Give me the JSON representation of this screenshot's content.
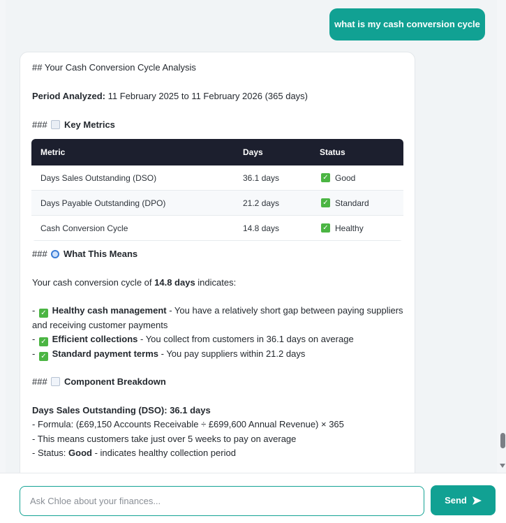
{
  "user_message": "what is my cash conversion cycle",
  "response": {
    "heading": "## Your Cash Conversion Cycle Analysis",
    "period_label": "Period Analyzed:",
    "period_value": " 11 February 2025 to 11 February 2026 (365 days)",
    "key_metrics_prefix": "### ",
    "key_metrics_title": "Key Metrics",
    "table": {
      "headers": [
        "Metric",
        "Days",
        "Status"
      ],
      "rows": [
        {
          "metric": "Days Sales Outstanding (DSO)",
          "days": "36.1 days",
          "status": "Good"
        },
        {
          "metric": "Days Payable Outstanding (DPO)",
          "days": "21.2 days",
          "status": "Standard"
        },
        {
          "metric": "Cash Conversion Cycle",
          "days": "14.8 days",
          "status": "Healthy"
        }
      ]
    },
    "means_prefix": "### ",
    "means_title": "What This Means",
    "indicates_pre": "Your cash conversion cycle of ",
    "indicates_bold": "14.8 days",
    "indicates_post": " indicates:",
    "bullets": [
      {
        "bold": "Healthy cash management",
        "text": " - You have a relatively short gap between paying suppliers",
        "cont": "and receiving customer payments"
      },
      {
        "bold": "Efficient collections",
        "text": " - You collect from customers in 36.1 days on average"
      },
      {
        "bold": "Standard payment terms",
        "text": " - You pay suppliers within 21.2 days"
      }
    ],
    "breakdown_prefix": "### ",
    "breakdown_title": "Component Breakdown",
    "dso_title": "Days Sales Outstanding (DSO): 36.1 days",
    "dso_formula": "- Formula: (£69,150 Accounts Receivable ÷ £699,600 Annual Revenue) × 365",
    "dso_means": "- This means customers take just over 5 weeks to pay on average",
    "dso_status_pre": "- Status: ",
    "dso_status_bold": "Good",
    "dso_status_post": " - indicates healthy collection period"
  },
  "input": {
    "placeholder": "Ask Chloe about your finances...",
    "send_label": "Send"
  },
  "colors": {
    "accent": "#11a193",
    "table_header": "#1c1f2e",
    "check": "#4bb543"
  },
  "icons": [
    "bar-chart-icon",
    "magnifier-icon",
    "trend-chart-icon",
    "check-icon",
    "send-arrow-icon"
  ]
}
